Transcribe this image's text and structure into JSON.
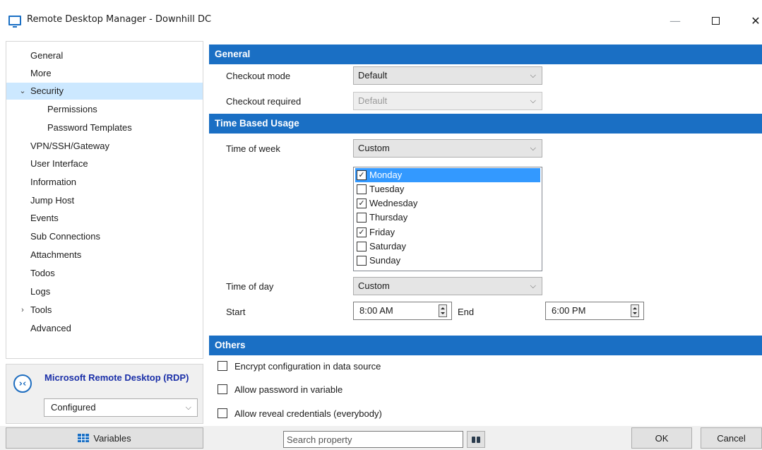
{
  "window": {
    "title": "Remote Desktop Manager - Downhill DC",
    "minimize": "—",
    "close": "✕"
  },
  "nav": {
    "items": [
      {
        "label": "General"
      },
      {
        "label": "More"
      },
      {
        "label": "Security",
        "expanded": true,
        "selected": true
      },
      {
        "label": "Permissions",
        "child": true
      },
      {
        "label": "Password Templates",
        "child": true
      },
      {
        "label": "VPN/SSH/Gateway"
      },
      {
        "label": "User Interface"
      },
      {
        "label": "Information"
      },
      {
        "label": "Jump Host"
      },
      {
        "label": "Events"
      },
      {
        "label": "Sub Connections"
      },
      {
        "label": "Attachments"
      },
      {
        "label": "Todos"
      },
      {
        "label": "Logs"
      },
      {
        "label": "Tools",
        "collapsed": true
      },
      {
        "label": "Advanced"
      }
    ],
    "chevron_expanded": "⌄",
    "chevron_collapsed": "›"
  },
  "entry_type": {
    "name": "Microsoft Remote Desktop (RDP)",
    "status": "Configured"
  },
  "sections": {
    "general": {
      "title": "General",
      "checkout_mode_label": "Checkout mode",
      "checkout_mode_value": "Default",
      "checkout_required_label": "Checkout required",
      "checkout_required_value": "Default"
    },
    "time_based": {
      "title": "Time Based Usage",
      "time_of_week_label": "Time of week",
      "time_of_week_value": "Custom",
      "days": [
        {
          "label": "Monday",
          "checked": true,
          "selected": true
        },
        {
          "label": "Tuesday",
          "checked": false
        },
        {
          "label": "Wednesday",
          "checked": true
        },
        {
          "label": "Thursday",
          "checked": false
        },
        {
          "label": "Friday",
          "checked": true
        },
        {
          "label": "Saturday",
          "checked": false
        },
        {
          "label": "Sunday",
          "checked": false
        }
      ],
      "time_of_day_label": "Time of day",
      "time_of_day_value": "Custom",
      "start_label": "Start",
      "start_value": "8:00 AM",
      "end_label": "End",
      "end_value": "6:00 PM"
    },
    "others": {
      "title": "Others",
      "options": [
        {
          "label": "Encrypt configuration in data source",
          "checked": false
        },
        {
          "label": "Allow password in variable",
          "checked": false
        },
        {
          "label": "Allow reveal credentials (everybody)",
          "checked": false
        }
      ]
    }
  },
  "footer": {
    "variables_label": "Variables",
    "search_placeholder": "Search property",
    "ok_label": "OK",
    "cancel_label": "Cancel"
  },
  "colors": {
    "accent": "#1a6fc4",
    "selection": "#cce8ff",
    "list_selection": "#3399ff",
    "entry_title": "#1a2fa8"
  }
}
